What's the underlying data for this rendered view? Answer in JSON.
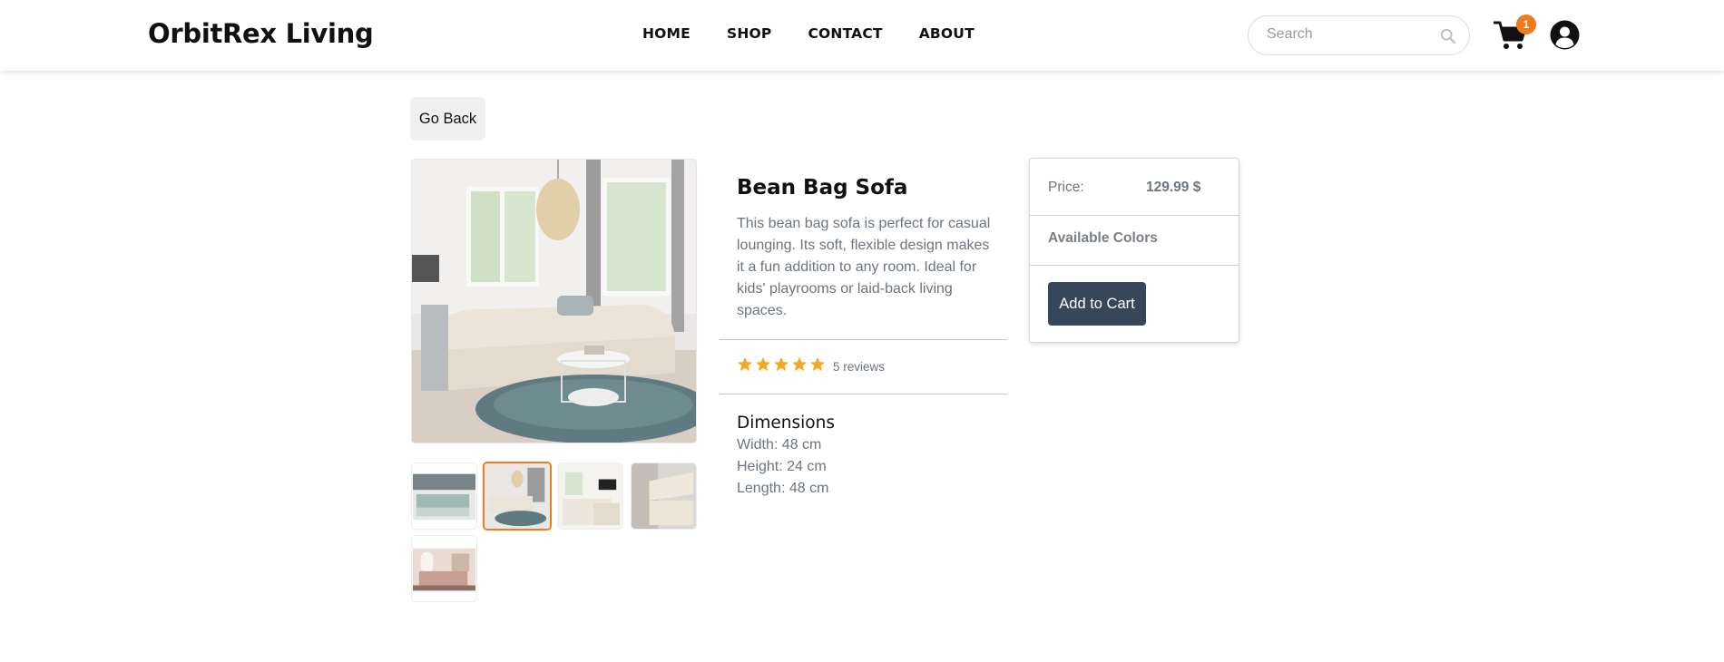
{
  "header": {
    "brand": "OrbitRex Living",
    "nav": [
      "HOME",
      "SHOP",
      "CONTACT",
      "ABOUT"
    ],
    "search_placeholder": "Search",
    "cart_count": "1"
  },
  "go_back_label": "Go Back",
  "product": {
    "title": "Bean Bag Sofa",
    "description": "This bean bag sofa is perfect for casual lounging. Its soft, flexible design makes it a fun addition to any room. Ideal for kids' playrooms or laid-back living spaces.",
    "rating": 5,
    "reviews_label": "5 reviews",
    "dimensions_title": "Dimensions",
    "width": "Width: 48 cm",
    "height": "Height: 24 cm",
    "length": "Length: 48 cm"
  },
  "purchase": {
    "price_label": "Price:",
    "price_value": "129.99 $",
    "colors_label": "Available Colors",
    "add_to_cart_label": "Add to Cart"
  },
  "colors": {
    "accent": "#f07b1a",
    "button": "#37475a",
    "star": "#f5a623"
  }
}
